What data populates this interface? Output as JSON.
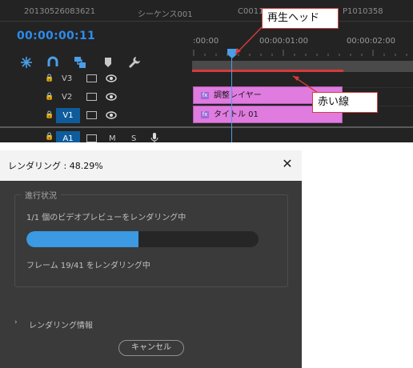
{
  "timeline": {
    "tabs": [
      "20130526083621",
      "シーケンス001",
      "C0011",
      "P1010358"
    ],
    "timecode": "00:00:00:11",
    "ruler_ticks": [
      ":00:00",
      "00:00:01:00",
      "00:00:02:00"
    ],
    "tools": [
      "snap-icon",
      "link-icon",
      "linked-selection-icon",
      "marker-icon",
      "wrench-icon"
    ],
    "tracks": [
      {
        "name": "V3",
        "highlighted": false
      },
      {
        "name": "V2",
        "highlighted": false
      },
      {
        "name": "V1",
        "highlighted": true
      },
      {
        "name": "A1",
        "highlighted": false,
        "mute": "M",
        "solo": "S"
      }
    ],
    "clips": [
      {
        "track": "V2",
        "label": "調整レイヤー"
      },
      {
        "track": "V1",
        "label": "タイトル 01"
      }
    ],
    "colors": {
      "accent": "#2d8ceb",
      "clip": "#e07be0",
      "playhead": "#4a9fe8",
      "render_bar": "#d83a3a"
    }
  },
  "callouts": {
    "playhead": "再生ヘッド",
    "red_line": "赤い線"
  },
  "dialog": {
    "title": "レンダリング : 48.29%",
    "group_label": "進行状況",
    "status": "1/1 個のビデオプレビューをレンダリング中",
    "progress_fraction": 0.4829,
    "frame_status": "フレーム  19/41 をレンダリング中",
    "details_label": "レンダリング情報",
    "cancel_label": "キャンセル"
  }
}
